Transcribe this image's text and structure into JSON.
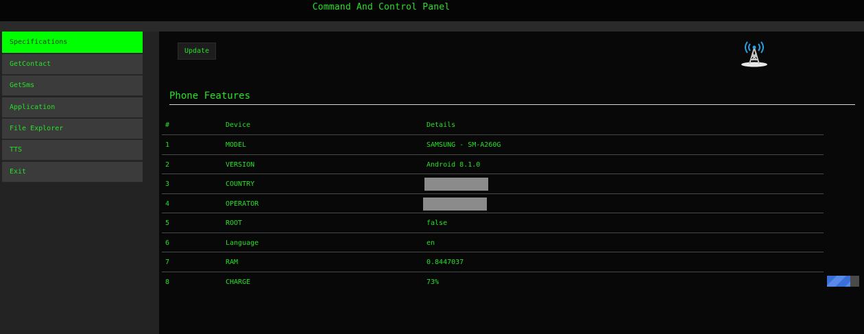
{
  "header": {
    "title": "Command And Control Panel"
  },
  "sidebar": {
    "items": [
      {
        "label": "Specifications",
        "active": true
      },
      {
        "label": "GetContact"
      },
      {
        "label": "GetSms"
      },
      {
        "label": "Application"
      },
      {
        "label": "File Explorer"
      },
      {
        "label": "TTS"
      },
      {
        "label": "Exit"
      }
    ]
  },
  "main": {
    "update_label": "Update",
    "tower_icon": "radio-tower-icon",
    "section_title": "Phone Features",
    "table": {
      "headers": [
        "#",
        "Device",
        "Details"
      ],
      "rows": [
        {
          "idx": "1",
          "device": "MODEL",
          "details": "SAMSUNG - SM-A260G"
        },
        {
          "idx": "2",
          "device": "VERSION",
          "details": "Android 8.1.0"
        },
        {
          "idx": "3",
          "device": "COUNTRY",
          "details": ""
        },
        {
          "idx": "4",
          "device": "OPERATOR",
          "details": ""
        },
        {
          "idx": "5",
          "device": "ROOT",
          "details": "false"
        },
        {
          "idx": "6",
          "device": "Language",
          "details": "en"
        },
        {
          "idx": "7",
          "device": "RAM",
          "details": "0.8447037"
        },
        {
          "idx": "8",
          "device": "CHARGE",
          "details": "73%"
        }
      ]
    },
    "charge_level": 0.73
  },
  "colors": {
    "accent": "#27e027",
    "active_nav": "#00ff00",
    "charge": "#3a6fd8"
  }
}
